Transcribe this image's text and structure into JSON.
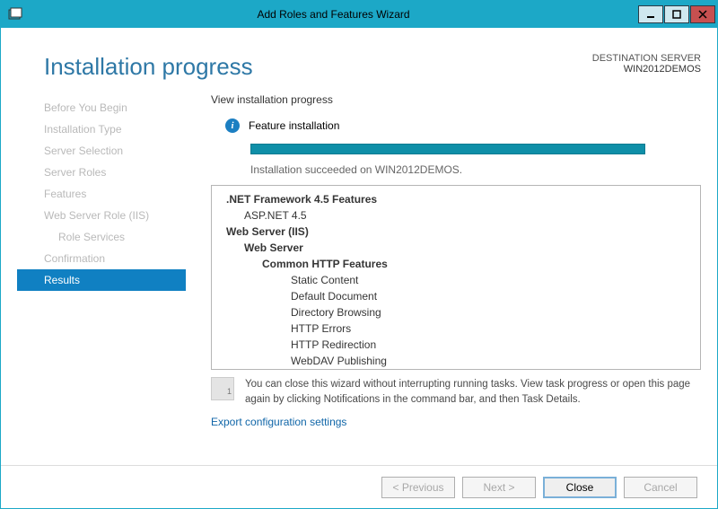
{
  "window": {
    "title": "Add Roles and Features Wizard"
  },
  "header": {
    "page_title": "Installation progress",
    "dest_label": "DESTINATION SERVER",
    "dest_server": "WIN2012DEMOS"
  },
  "sidebar": {
    "items": [
      {
        "label": "Before You Begin",
        "state": "disabled"
      },
      {
        "label": "Installation Type",
        "state": "disabled"
      },
      {
        "label": "Server Selection",
        "state": "disabled"
      },
      {
        "label": "Server Roles",
        "state": "disabled"
      },
      {
        "label": "Features",
        "state": "disabled"
      },
      {
        "label": "Web Server Role (IIS)",
        "state": "disabled"
      },
      {
        "label": "Role Services",
        "state": "disabled",
        "sub": true
      },
      {
        "label": "Confirmation",
        "state": "disabled"
      },
      {
        "label": "Results",
        "state": "active"
      }
    ]
  },
  "main": {
    "subhead": "View installation progress",
    "status_text": "Feature installation",
    "success_msg": "Installation succeeded on WIN2012DEMOS.",
    "tree": [
      {
        "label": ".NET Framework 4.5 Features",
        "cls": "l0"
      },
      {
        "label": "ASP.NET 4.5",
        "cls": "l1"
      },
      {
        "label": "Web Server (IIS)",
        "cls": "l0b"
      },
      {
        "label": "Web Server",
        "cls": "l1b"
      },
      {
        "label": "Common HTTP Features",
        "cls": "l2"
      },
      {
        "label": "Static Content",
        "cls": "l3"
      },
      {
        "label": "Default Document",
        "cls": "l3"
      },
      {
        "label": "Directory Browsing",
        "cls": "l3"
      },
      {
        "label": "HTTP Errors",
        "cls": "l3"
      },
      {
        "label": "HTTP Redirection",
        "cls": "l3"
      },
      {
        "label": "WebDAV Publishing",
        "cls": "l3"
      }
    ],
    "hint": "You can close this wizard without interrupting running tasks. View task progress or open this page again by clicking Notifications in the command bar, and then Task Details.",
    "export_link": "Export configuration settings"
  },
  "footer": {
    "previous": "< Previous",
    "next": "Next >",
    "close": "Close",
    "cancel": "Cancel"
  }
}
